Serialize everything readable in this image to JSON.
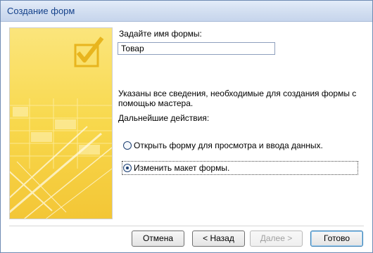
{
  "window": {
    "title": "Создание форм"
  },
  "form_name": {
    "label": "Задайте имя формы:",
    "value": "Товар"
  },
  "description": "Указаны все сведения, необходимые для создания формы с помощью мастера.",
  "next_actions": {
    "label": "Дальнейшие действия:",
    "options": [
      {
        "label": "Открыть форму для просмотра и ввода данных.",
        "selected": false
      },
      {
        "label": "Изменить макет формы.",
        "selected": true
      }
    ]
  },
  "buttons": {
    "cancel": "Отмена",
    "back": "< Назад",
    "next": "Далее >",
    "finish": "Готово"
  },
  "colors": {
    "panel_yellow": "#f9d94a",
    "title_text": "#15428b"
  }
}
